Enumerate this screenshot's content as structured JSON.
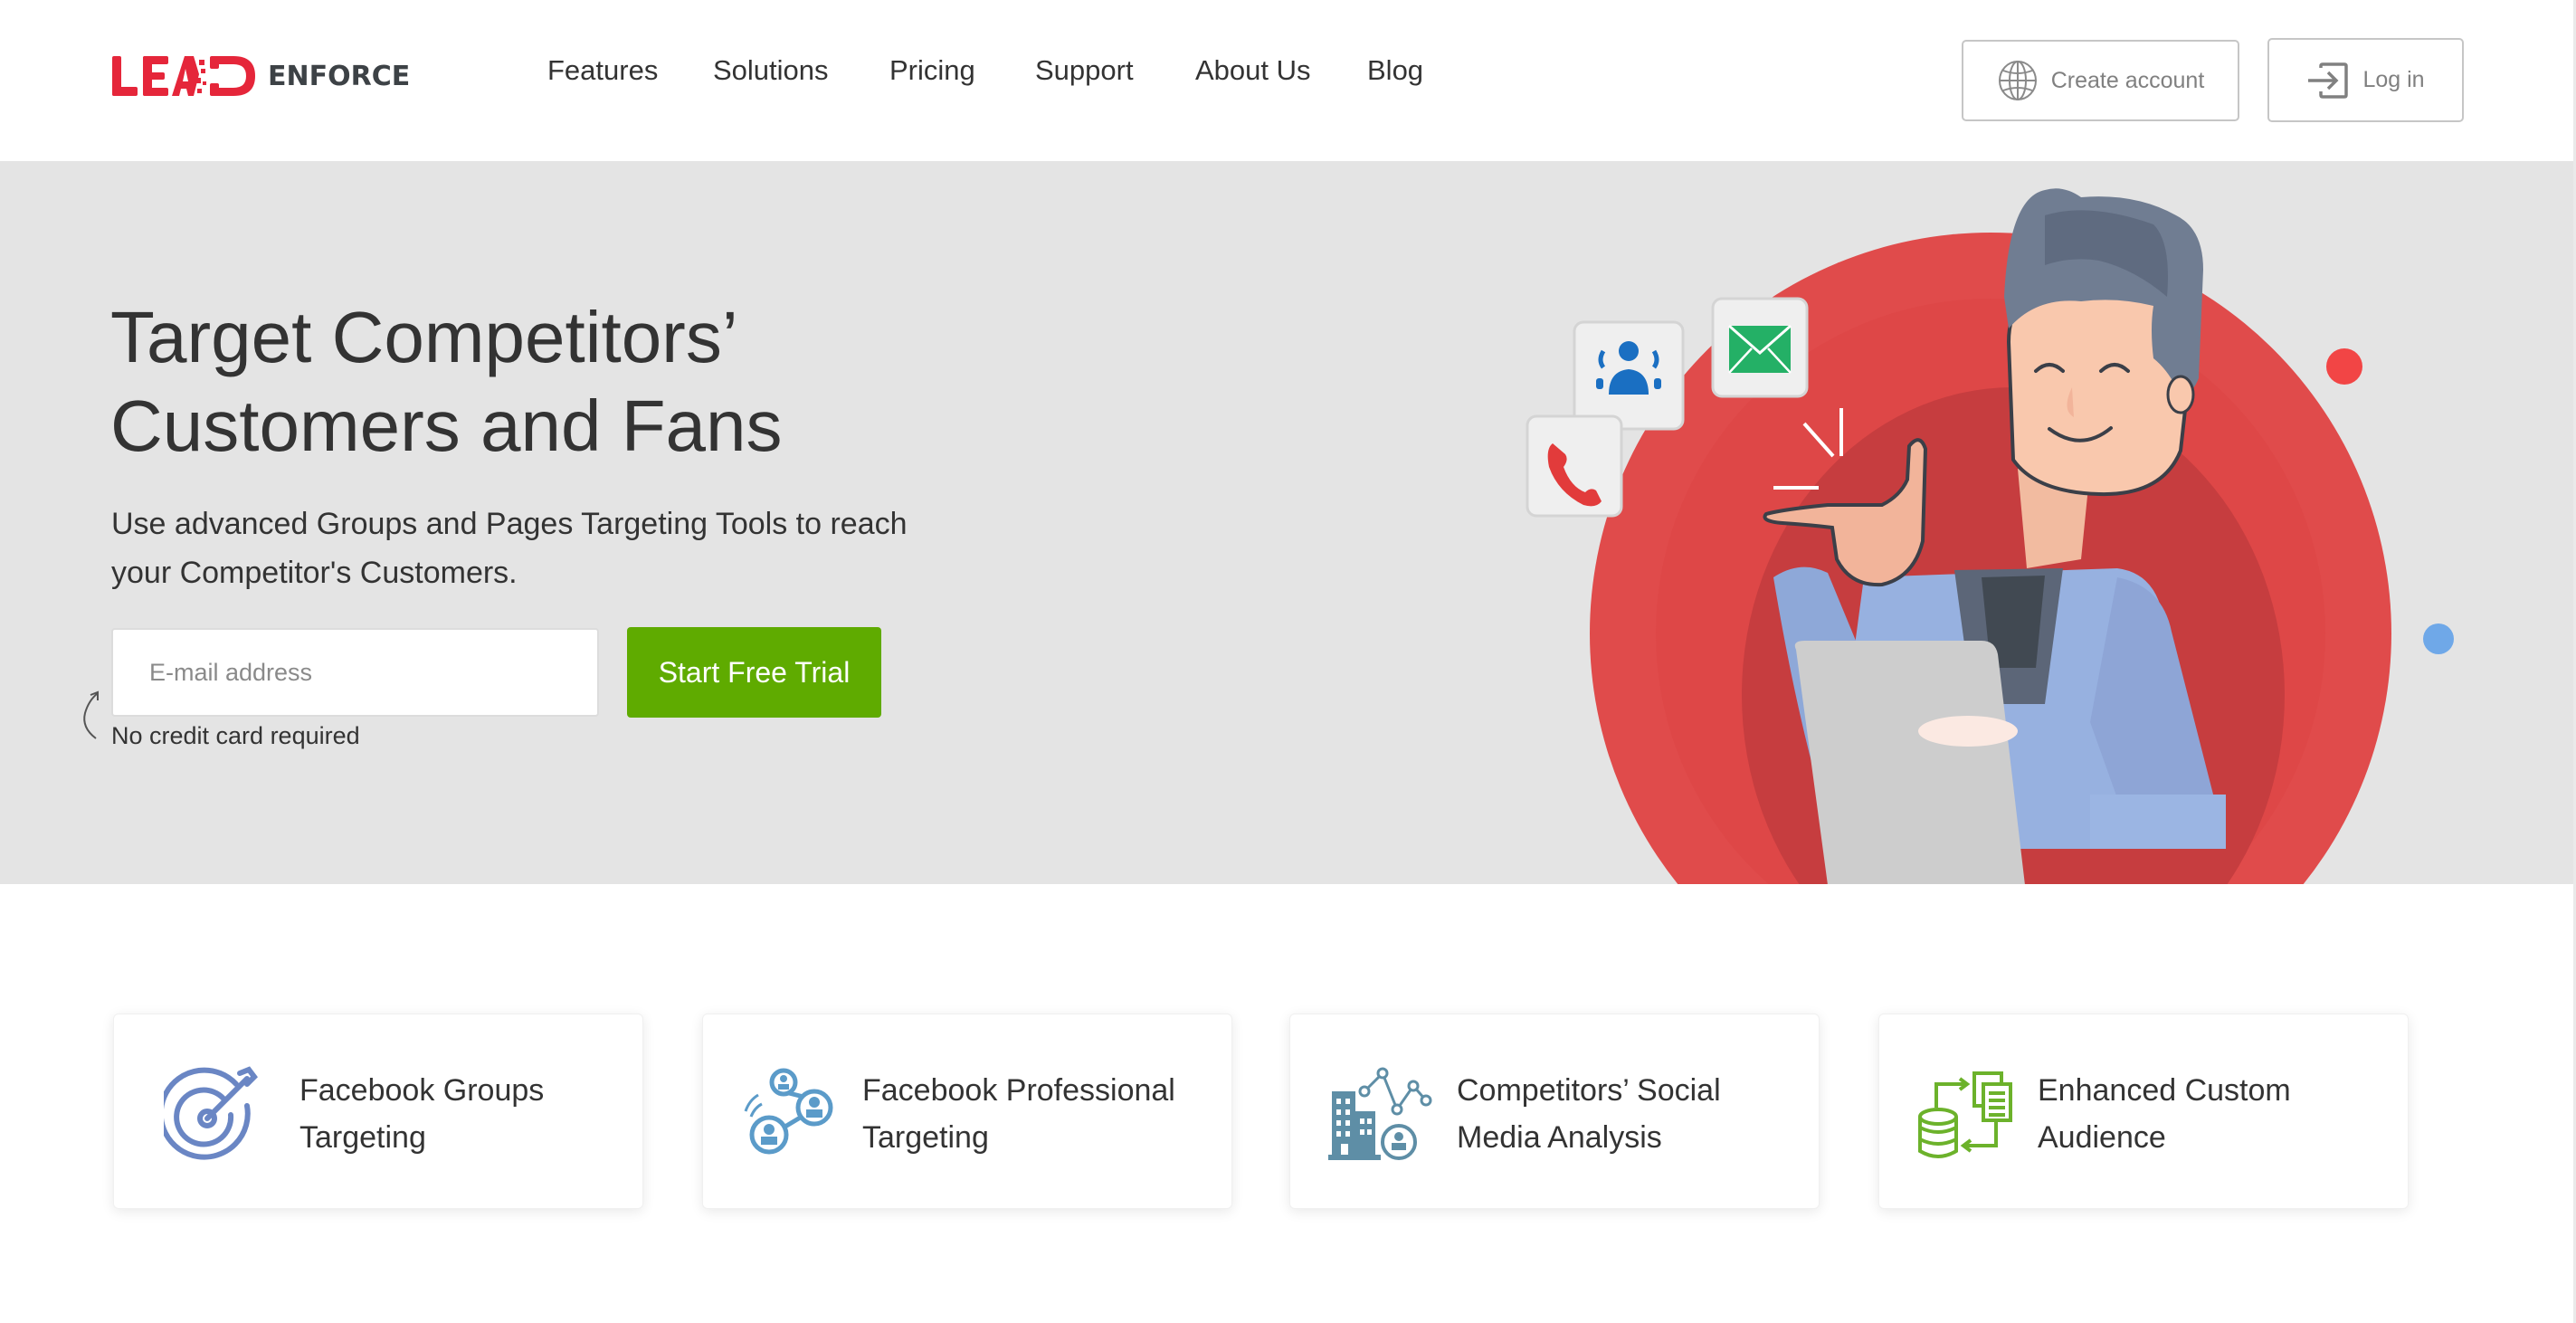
{
  "brand": {
    "logo_primary": "LEAD",
    "logo_secondary": "ENFORCE",
    "primary_color": "#e5263a",
    "secondary_color": "#3d4246"
  },
  "nav": {
    "items": [
      {
        "label": "Features"
      },
      {
        "label": "Solutions"
      },
      {
        "label": "Pricing"
      },
      {
        "label": "Support"
      },
      {
        "label": "About Us"
      },
      {
        "label": "Blog"
      }
    ],
    "create_account": {
      "label": "Create account",
      "icon": "globe-icon"
    },
    "login": {
      "label": "Log in",
      "icon": "login-icon"
    }
  },
  "hero": {
    "title_line1": "Target Competitors’",
    "title_line2": "Customers and Fans",
    "subtitle_line1": "Use advanced Groups and Pages Targeting Tools to reach",
    "subtitle_line2": "your Competitor's Customers.",
    "email_placeholder": "E-mail address",
    "email_value": "",
    "cta_label": "Start Free Trial",
    "cta_color": "#5fab00",
    "note": "No credit card required",
    "illustration": {
      "bubbles": [
        "group-icon",
        "mail-icon",
        "phone-icon"
      ],
      "accent_red": "#e8474a",
      "accent_blue": "#6fa8e8"
    }
  },
  "features": [
    {
      "line1": "Facebook Groups",
      "line2": "Targeting",
      "icon": "target-icon",
      "color": "#6a86c4"
    },
    {
      "line1": "Facebook Professional",
      "line2": "Targeting",
      "icon": "network-people-icon",
      "color": "#5b9bc9"
    },
    {
      "line1": "Competitors’ Social",
      "line2": "Media Analysis",
      "icon": "building-analytics-icon",
      "color": "#5e8ea6"
    },
    {
      "line1": "Enhanced Custom",
      "line2": "Audience",
      "icon": "database-sync-icon",
      "color": "#6cb22b"
    }
  ]
}
